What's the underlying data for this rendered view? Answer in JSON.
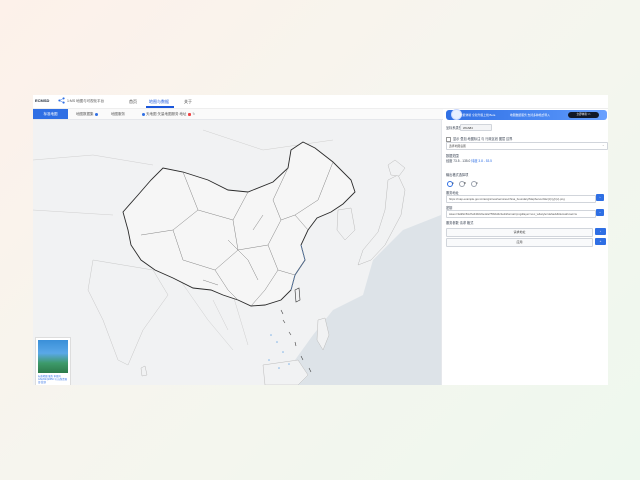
{
  "app": {
    "logo": "ECMSD",
    "project": "1:MS 地图与可视化平台",
    "nav_tabs": [
      "首页",
      "地图与数据",
      "关于"
    ],
    "active_nav": "地图与数据"
  },
  "banner": {
    "text1": "智能体验 全新升级上线 Beta",
    "text2": "地图数据服务 支持多种格式导入",
    "button": "立即体验 >>"
  },
  "subtabs": [
    {
      "label": "标准地图",
      "active": true
    },
    {
      "label": "地图数据集",
      "dot": "blue"
    },
    {
      "label": "地图服务"
    },
    {
      "label": "天地图 矢量地图服务 地址",
      "dot": "red"
    }
  ],
  "panel": {
    "mode_label": "坐标系类型",
    "mode_value": "WGS84",
    "checkbox_label": "显示 叠加 地图标注 与 行政区划 图层 边界",
    "dropdown_value": "选择地图底图",
    "range_label": "数据范围",
    "range_text": "经度 73.5 - 135.0",
    "range_link": "纬度 3.8 - 53.5",
    "output_label": "输出格式选择项",
    "radio_options": [
      "A",
      "B",
      "C"
    ],
    "url_label": "服务地址",
    "url_value": "https://map.example.gov.cn/arcgis/rest/services/china_boundary/MapServer/tile/{z}/{y}/{x}.png",
    "key_label": "密钥",
    "key_value": "token=3a9f2c81d7e64b0c9e12a7f5b6d4c3e2&format=png&layer=vec_w&style=default&tilematrixset=w",
    "params_label": "服务参数 请求 格式",
    "row1_value": "请求地址",
    "row2_value": "应用",
    "thumbnail_caption": "标准地图 服务 审图号 GS(2024)0650 号 自然资源部 监制"
  }
}
